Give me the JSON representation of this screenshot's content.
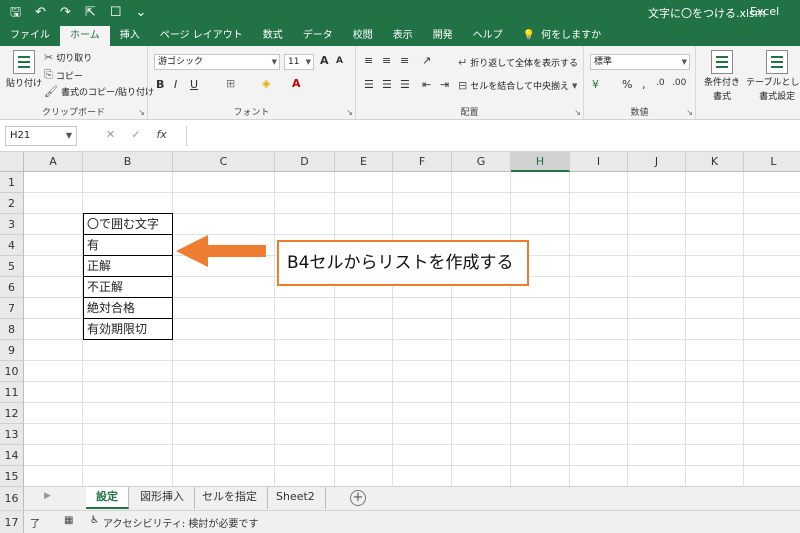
{
  "window": {
    "filename": "文字に〇をつける.xlsm",
    "app": "Excel"
  },
  "qat": {
    "save": "🖫",
    "undo": "↶",
    "redo": "↷",
    "pointer": "⇱",
    "touch": "☐",
    "more": "⌄"
  },
  "tabs": [
    "ファイル",
    "ホーム",
    "挿入",
    "ページ レイアウト",
    "数式",
    "データ",
    "校閲",
    "表示",
    "開発",
    "ヘルプ"
  ],
  "tell_me": "何をしますか",
  "ribbon": {
    "clipboard": {
      "paste": "貼り付け",
      "cut": "切り取り",
      "copy": "コピー",
      "format_painter": "書式のコピー/貼り付け",
      "label": "クリップボード"
    },
    "font": {
      "name": "游ゴシック",
      "size": "11",
      "label": "フォント"
    },
    "alignment": {
      "wrap": "折り返して全体を表示する",
      "merge": "セルを結合して中央揃え",
      "label": "配置"
    },
    "number": {
      "format": "標準",
      "label": "数値"
    },
    "styles": {
      "conditional": "条件付き",
      "conditional2": "書式",
      "table": "テーブルとして",
      "table2": "書式設定"
    }
  },
  "formula_bar": {
    "name_box": "H21",
    "cancel": "✕",
    "enter": "✓",
    "fx": "fx"
  },
  "columns": [
    "A",
    "B",
    "C",
    "D",
    "E",
    "F",
    "G",
    "H",
    "I",
    "J",
    "K",
    "L"
  ],
  "selected_column": "H",
  "rows": [
    "1",
    "2",
    "3",
    "4",
    "5",
    "6",
    "7",
    "8",
    "9",
    "10",
    "11",
    "12",
    "13",
    "14",
    "15"
  ],
  "cells_b": [
    "〇で囲む文字",
    "有",
    "正解",
    "不正解",
    "絶対合格",
    "有効期限切"
  ],
  "callout": "B4セルからリストを作成する",
  "callout_color": "#ed7d31",
  "sheet_row": "16",
  "sheets": [
    "設定",
    "図形挿入",
    "セルを指定",
    "Sheet2"
  ],
  "active_sheet": "設定",
  "add_sheet": "+",
  "status": {
    "row": "17",
    "ready": "了",
    "accessibility": "アクセシビリティ: 検討が必要です"
  },
  "colors": {
    "excel_green": "#217346"
  }
}
